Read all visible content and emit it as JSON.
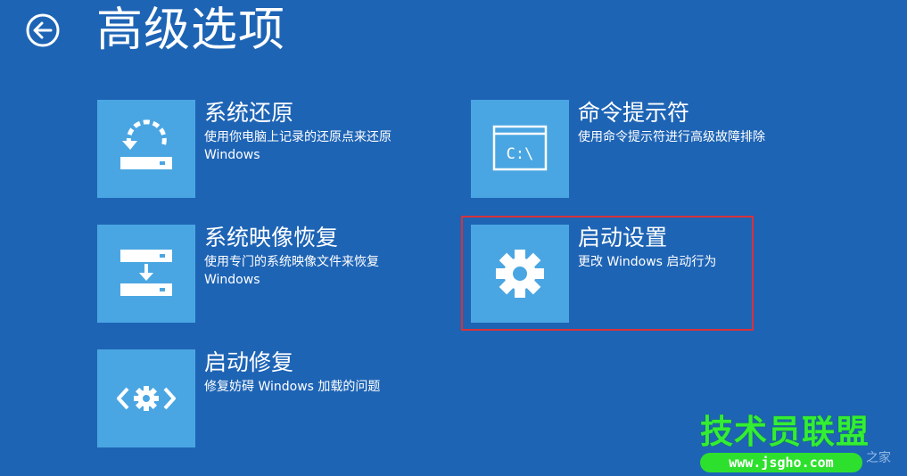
{
  "page": {
    "title": "高级选项",
    "back_icon": "back-arrow-icon"
  },
  "options": [
    {
      "title": "系统还原",
      "description": "使用你电脑上记录的还原点来还原 Windows",
      "icon": "system-restore-icon"
    },
    {
      "title": "命令提示符",
      "description": "使用命令提示符进行高级故障排除",
      "icon": "command-prompt-icon"
    },
    {
      "title": "系统映像恢复",
      "description": "使用专门的系统映像文件来恢复 Windows",
      "icon": "system-image-recovery-icon"
    },
    {
      "title": "启动设置",
      "description": "更改 Windows 启动行为",
      "icon": "startup-settings-gear-icon"
    },
    {
      "title": "启动修复",
      "description": "修复妨碍 Windows 加载的问题",
      "icon": "startup-repair-icon"
    }
  ],
  "command_prompt_glyph": "C:\\",
  "watermark": {
    "title": "技术员联盟",
    "url": "www.jsgho.com",
    "extra": "之家"
  },
  "colors": {
    "background": "#1e64b5",
    "tile": "#4aa6e2",
    "highlight": "#d8323a",
    "watermark": "#33ee33"
  }
}
